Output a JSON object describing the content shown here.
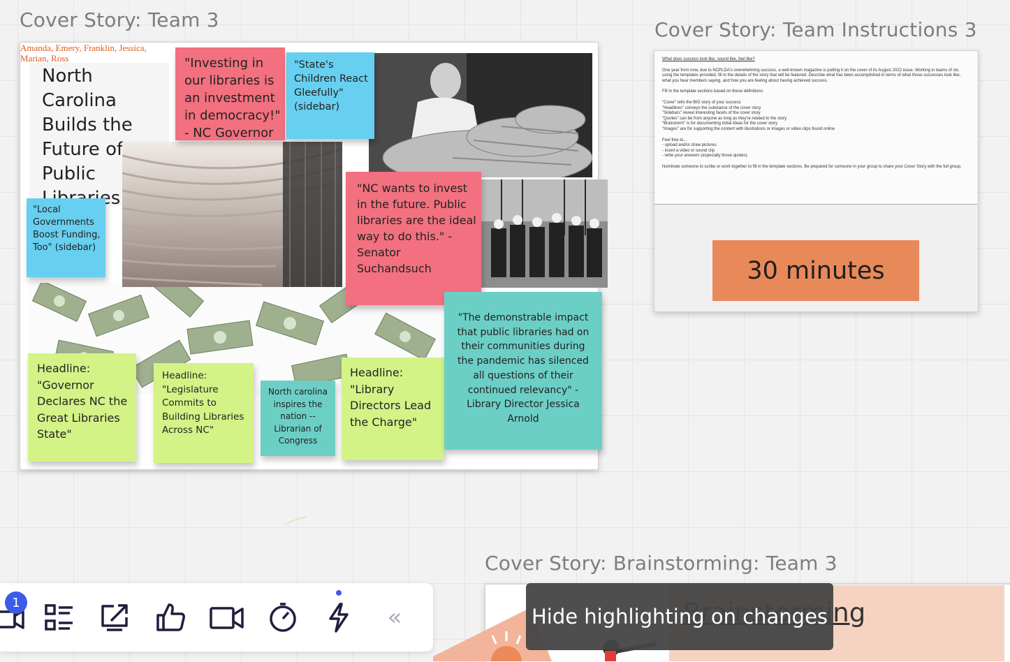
{
  "frames": {
    "cover_story": {
      "title": "Cover Story: Team 3",
      "members": "Amanda, Emery, Franklin, Jessica, Marian, Ross",
      "headline_title": "North Carolina Builds the Future of Public Libraries"
    },
    "instructions": {
      "title": "Cover Story: Team Instructions 3",
      "heading": "What does success look like, sound like, feel like?",
      "para1": "One year from now, due to NCPLDA's overwhelming success, a well-known magazine is putting it on the cover of its August 2022 issue. Working in teams of six, using the templates provided, fill in the details of the story that will be featured. Describe what has been accomplished in terms of what those successes look like, what you hear members saying, and how you are feeling about having achieved success.",
      "para2": "Fill in the template sections based on these definitions:",
      "definitions": [
        "\"Cover\" tells the BIG story of your success",
        "\"Headlines\" conveys the substance of the cover story",
        "\"Sidebars\" reveal interesting facets of the cover story",
        "\"Quotes\" can be from anyone as long as they're related to the story",
        "\"Brainstorm\" is for documenting initial ideas for the cover story",
        "\"Images\" are for supporting the content with illustrations or images or video clips found online"
      ],
      "feel_free": "Feel free to...",
      "free_items": [
        "-  upload and/or draw pictures",
        "-  insert a video or sound clip",
        "-  write your answers (especially those quotes)"
      ],
      "nominate": "Nominate someone to scribe or work together to fill in the template sections. Be prepared for someone in your group to share your Cover Story with the full group.",
      "timer_label": "30 minutes",
      "timer_color": "#e8895a"
    },
    "brainstorm": {
      "title": "Cover Story: Brainstorming: Team 3",
      "heading": "Brainstorming"
    }
  },
  "stickies": {
    "quote_governor": "\"Investing in our libraries is an investment in democracy!\" - NC Governor",
    "sidebar_children": "\"State's Children React Gleefully\" (sidebar)",
    "sidebar_local": "\"Local Governments Boost Funding, Too\" (sidebar)",
    "quote_senator": "\"NC wants to invest in the future. Public libraries are the ideal way to do this.\" - Senator Suchandsuch",
    "headline_governor": "Headline: \"Governor Declares NC the Great Libraries State\"",
    "headline_legislature": "Headline: \"Legislature Commits to Building Libraries Across NC\"",
    "nc_inspires": "North carolina inspires the nation -- Librarian of Congress",
    "headline_directors": "Headline: \"Library Directors Lead the Charge\"",
    "quote_director": "\"The demonstrable impact that public libraries had on their communities during the pandemic has silenced all questions of their continued relevancy\" - Library Director Jessica Arnold"
  },
  "toolbar": {
    "badge_count": "1",
    "icons": [
      "video-chat-icon",
      "list-icon",
      "share-screen-icon",
      "thumbs-up-icon",
      "video-camera-icon",
      "timer-icon",
      "lightning-icon",
      "collapse-icon"
    ],
    "collapse_label": "«"
  },
  "tooltip": {
    "text": "Hide highlighting on changes"
  },
  "colors": {
    "pink": "#f2707f",
    "blue": "#67cfef",
    "lime": "#d3f387",
    "teal": "#6ccfc6",
    "accent_badge": "#3b5ce8"
  }
}
